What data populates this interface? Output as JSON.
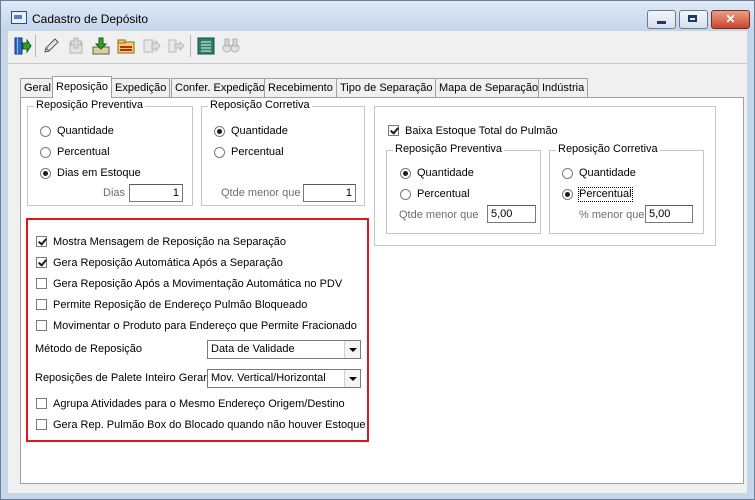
{
  "window": {
    "title": "Cadastro de Depósito",
    "minimize_label": "",
    "close_label": "✕"
  },
  "toolbar": {
    "buttons": [
      "exit-icon",
      "edit-icon",
      "add-icon",
      "save-icon",
      "open-folder-icon",
      "move-icon",
      "transfer-icon",
      "grid-list-icon",
      "binoculars-icon"
    ]
  },
  "tabs": [
    {
      "label": "Geral"
    },
    {
      "label": "Reposição"
    },
    {
      "label": "Expedição"
    },
    {
      "label": "Confer. Expedição"
    },
    {
      "label": "Recebimento"
    },
    {
      "label": "Tipo de Separação"
    },
    {
      "label": "Mapa de Separação"
    },
    {
      "label": "Indústria"
    }
  ],
  "active_tab": "Reposição",
  "reposicao_preventiva": {
    "title": "Reposição Preventiva",
    "options": [
      {
        "label": "Quantidade",
        "selected": false
      },
      {
        "label": "Percentual",
        "selected": false
      },
      {
        "label": "Dias em Estoque",
        "selected": true
      }
    ],
    "dias_label": "Dias",
    "dias_value": "1"
  },
  "reposicao_corretiva": {
    "title": "Reposição Corretiva",
    "options": [
      {
        "label": "Quantidade",
        "selected": true
      },
      {
        "label": "Percentual",
        "selected": false
      }
    ],
    "qtde_label": "Qtde menor que",
    "qtde_value": "1"
  },
  "baixa_estoque": {
    "label": "Baixa Estoque Total do Pulmão",
    "checked": true,
    "preventiva": {
      "title": "Reposição Preventiva",
      "options": [
        {
          "label": "Quantidade",
          "selected": true
        },
        {
          "label": "Percentual",
          "selected": false
        }
      ],
      "field_label": "Qtde menor que",
      "field_value": "5,00"
    },
    "corretiva": {
      "title": "Reposição Corretiva",
      "options": [
        {
          "label": "Quantidade",
          "selected": false
        },
        {
          "label": "Percentual",
          "selected": true
        }
      ],
      "field_label": "% menor que",
      "field_value": "5,00"
    }
  },
  "options": {
    "checkboxes": [
      {
        "label": "Mostra Mensagem de Reposição na Separação",
        "checked": true
      },
      {
        "label": "Gera Reposição Automática Após a Separação",
        "checked": true
      },
      {
        "label": "Gera Reposição Após a Movimentação Automática no PDV",
        "checked": false
      },
      {
        "label": "Permite Reposição de Endereço Pulmão Bloqueado",
        "checked": false
      },
      {
        "label": "Movimentar o Produto para Endereço que Permite Fracionado",
        "checked": false
      }
    ],
    "metodo_label": "Método de Reposição",
    "metodo_value": "Data de Validade",
    "palete_label": "Reposições de Palete Inteiro Gerar",
    "palete_value": "Mov. Vertical/Horizontal",
    "checkboxes_bottom": [
      {
        "label": "Agrupa Atividades para o Mesmo Endereço Origem/Destino",
        "checked": false
      },
      {
        "label": "Gera Rep. Pulmão Box do Blocado quando não houver Estoque",
        "checked": false
      }
    ]
  },
  "colors": {
    "highlight": "#e0161b",
    "window_frame": "#c7d7ea"
  }
}
